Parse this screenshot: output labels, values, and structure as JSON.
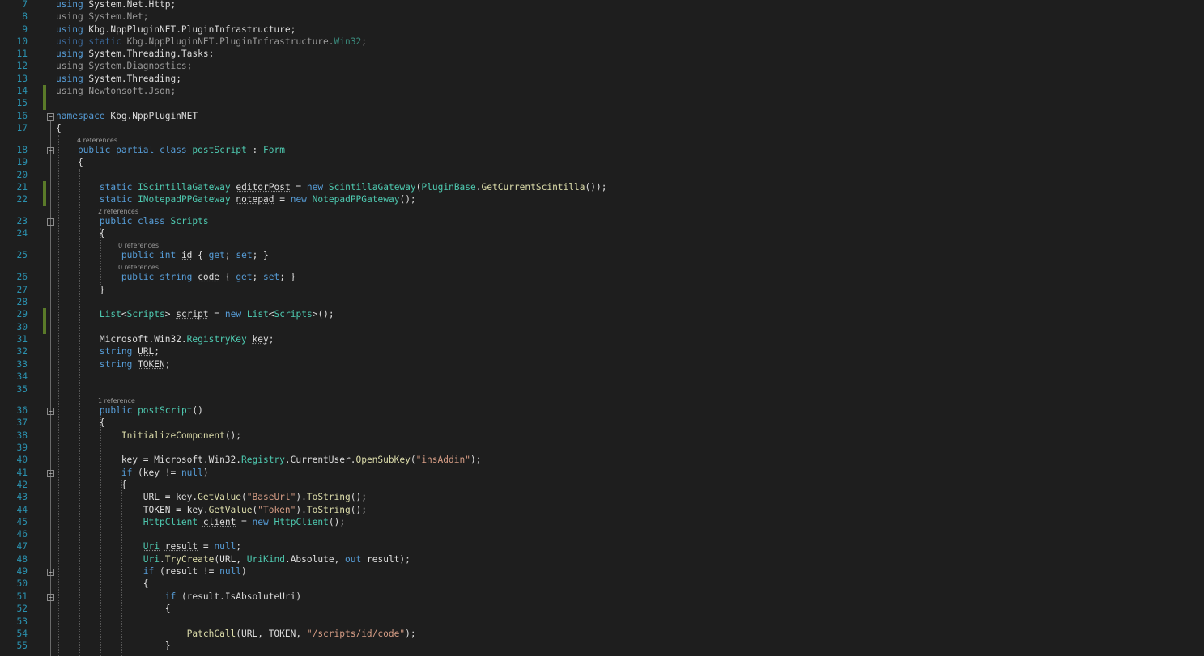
{
  "editor": {
    "background": "#1e1e1e",
    "language": "C#",
    "colors": {
      "keyword": "#569cd6",
      "type": "#4ec9b0",
      "method": "#dcdcaa",
      "string": "#d69d85",
      "line_number": "#2b91af",
      "unused_using": "#9b9b9b",
      "change_marker": "#5a7a29"
    },
    "lens": {
      "form_class": "4 references",
      "scripts_class": "2 references",
      "id_prop": "0 references",
      "code_prop": "0 references",
      "ctor": "1 reference"
    },
    "lines": [
      {
        "num": "7",
        "tokens": [
          {
            "t": "using",
            "c": "kw"
          },
          {
            "t": " System.Net.Http;",
            "c": "tx"
          }
        ]
      },
      {
        "num": "8",
        "tokens": [
          {
            "t": "using System.Net;",
            "c": "dim"
          }
        ]
      },
      {
        "num": "9",
        "tokens": [
          {
            "t": "using",
            "c": "kw"
          },
          {
            "t": " Kbg.NppPluginNET.PluginInfrastructure;",
            "c": "tx"
          }
        ]
      },
      {
        "num": "10",
        "tokens": [
          {
            "t": "using static",
            "c": "dimkw"
          },
          {
            "t": " Kbg.NppPluginNET.PluginInfrastructure.",
            "c": "dim"
          },
          {
            "t": "Win32",
            "c": "dimty"
          },
          {
            "t": ";",
            "c": "dim"
          }
        ]
      },
      {
        "num": "11",
        "tokens": [
          {
            "t": "using",
            "c": "kw"
          },
          {
            "t": " System.Threading.Tasks;",
            "c": "tx"
          }
        ]
      },
      {
        "num": "12",
        "tokens": [
          {
            "t": "using System.Diagnostics;",
            "c": "dim"
          }
        ]
      },
      {
        "num": "13",
        "tokens": [
          {
            "t": "using",
            "c": "kw"
          },
          {
            "t": " System.Threading;",
            "c": "tx"
          }
        ]
      },
      {
        "num": "14",
        "tokens": [
          {
            "t": "using Newtonsoft.Json;",
            "c": "dim"
          }
        ]
      },
      {
        "num": "15",
        "tokens": []
      },
      {
        "num": "16",
        "tokens": [
          {
            "t": "namespace",
            "c": "kw"
          },
          {
            "t": " Kbg.NppPluginNET",
            "c": "tx"
          }
        ]
      },
      {
        "num": "17",
        "tokens": [
          {
            "t": "{",
            "c": "tx"
          }
        ]
      },
      {
        "num": "18",
        "tokens": [
          {
            "t": "    ",
            "c": "tx"
          },
          {
            "t": "public partial class",
            "c": "kw"
          },
          {
            "t": " ",
            "c": "tx"
          },
          {
            "t": "postScript",
            "c": "ty"
          },
          {
            "t": " : ",
            "c": "tx"
          },
          {
            "t": "Form",
            "c": "ty"
          }
        ]
      },
      {
        "num": "19",
        "tokens": [
          {
            "t": "    {",
            "c": "tx"
          }
        ]
      },
      {
        "num": "20",
        "tokens": []
      },
      {
        "num": "21",
        "tokens": [
          {
            "t": "        ",
            "c": "tx"
          },
          {
            "t": "static",
            "c": "kw"
          },
          {
            "t": " ",
            "c": "tx"
          },
          {
            "t": "IScintillaGateway",
            "c": "ty"
          },
          {
            "t": " ",
            "c": "tx"
          },
          {
            "t": "editorPost",
            "c": "tx",
            "u": 1
          },
          {
            "t": " = ",
            "c": "tx"
          },
          {
            "t": "new",
            "c": "kw"
          },
          {
            "t": " ",
            "c": "tx"
          },
          {
            "t": "ScintillaGateway",
            "c": "ty"
          },
          {
            "t": "(",
            "c": "tx"
          },
          {
            "t": "PluginBase",
            "c": "ty"
          },
          {
            "t": ".",
            "c": "tx"
          },
          {
            "t": "GetCurrentScintilla",
            "c": "fn"
          },
          {
            "t": "());",
            "c": "tx"
          }
        ]
      },
      {
        "num": "22",
        "tokens": [
          {
            "t": "        ",
            "c": "tx"
          },
          {
            "t": "static",
            "c": "kw"
          },
          {
            "t": " ",
            "c": "tx"
          },
          {
            "t": "INotepadPPGateway",
            "c": "ty"
          },
          {
            "t": " ",
            "c": "tx"
          },
          {
            "t": "notepad",
            "c": "tx",
            "u": 1
          },
          {
            "t": " = ",
            "c": "tx"
          },
          {
            "t": "new",
            "c": "kw"
          },
          {
            "t": " ",
            "c": "tx"
          },
          {
            "t": "NotepadPPGateway",
            "c": "ty"
          },
          {
            "t": "();",
            "c": "tx"
          }
        ]
      },
      {
        "num": "23",
        "tokens": [
          {
            "t": "        ",
            "c": "tx"
          },
          {
            "t": "public class",
            "c": "kw"
          },
          {
            "t": " ",
            "c": "tx"
          },
          {
            "t": "Scripts",
            "c": "ty"
          }
        ]
      },
      {
        "num": "24",
        "tokens": [
          {
            "t": "        {",
            "c": "tx"
          }
        ]
      },
      {
        "num": "25",
        "tokens": [
          {
            "t": "            ",
            "c": "tx"
          },
          {
            "t": "public int",
            "c": "kw"
          },
          {
            "t": " ",
            "c": "tx"
          },
          {
            "t": "id",
            "c": "tx",
            "u": 1
          },
          {
            "t": " { ",
            "c": "tx"
          },
          {
            "t": "get",
            "c": "kw"
          },
          {
            "t": "; ",
            "c": "tx"
          },
          {
            "t": "set",
            "c": "kw"
          },
          {
            "t": "; }",
            "c": "tx"
          }
        ]
      },
      {
        "num": "26",
        "tokens": [
          {
            "t": "            ",
            "c": "tx"
          },
          {
            "t": "public string",
            "c": "kw"
          },
          {
            "t": " ",
            "c": "tx"
          },
          {
            "t": "code",
            "c": "tx",
            "u": 1
          },
          {
            "t": " { ",
            "c": "tx"
          },
          {
            "t": "get",
            "c": "kw"
          },
          {
            "t": "; ",
            "c": "tx"
          },
          {
            "t": "set",
            "c": "kw"
          },
          {
            "t": "; }",
            "c": "tx"
          }
        ]
      },
      {
        "num": "27",
        "tokens": [
          {
            "t": "        }",
            "c": "tx"
          }
        ]
      },
      {
        "num": "28",
        "tokens": []
      },
      {
        "num": "29",
        "tokens": [
          {
            "t": "        ",
            "c": "tx"
          },
          {
            "t": "List",
            "c": "ty"
          },
          {
            "t": "<",
            "c": "tx"
          },
          {
            "t": "Scripts",
            "c": "ty"
          },
          {
            "t": "> ",
            "c": "tx"
          },
          {
            "t": "script",
            "c": "tx",
            "u": 1
          },
          {
            "t": " = ",
            "c": "tx"
          },
          {
            "t": "new",
            "c": "kw"
          },
          {
            "t": " ",
            "c": "tx"
          },
          {
            "t": "List",
            "c": "ty"
          },
          {
            "t": "<",
            "c": "tx"
          },
          {
            "t": "Scripts",
            "c": "ty"
          },
          {
            "t": ">();",
            "c": "tx"
          }
        ]
      },
      {
        "num": "30",
        "tokens": []
      },
      {
        "num": "31",
        "tokens": [
          {
            "t": "        Microsoft.Win32.",
            "c": "tx"
          },
          {
            "t": "RegistryKey",
            "c": "ty"
          },
          {
            "t": " ",
            "c": "tx"
          },
          {
            "t": "key",
            "c": "tx",
            "u": 1
          },
          {
            "t": ";",
            "c": "tx"
          }
        ]
      },
      {
        "num": "32",
        "tokens": [
          {
            "t": "        ",
            "c": "tx"
          },
          {
            "t": "string",
            "c": "kw"
          },
          {
            "t": " ",
            "c": "tx"
          },
          {
            "t": "URL",
            "c": "tx",
            "u": 1
          },
          {
            "t": ";",
            "c": "tx"
          }
        ]
      },
      {
        "num": "33",
        "tokens": [
          {
            "t": "        ",
            "c": "tx"
          },
          {
            "t": "string",
            "c": "kw"
          },
          {
            "t": " ",
            "c": "tx"
          },
          {
            "t": "TOKEN",
            "c": "tx",
            "u": 1
          },
          {
            "t": ";",
            "c": "tx"
          }
        ]
      },
      {
        "num": "34",
        "tokens": []
      },
      {
        "num": "35",
        "tokens": []
      },
      {
        "num": "36",
        "tokens": [
          {
            "t": "        ",
            "c": "tx"
          },
          {
            "t": "public",
            "c": "kw"
          },
          {
            "t": " ",
            "c": "tx"
          },
          {
            "t": "postScript",
            "c": "ty"
          },
          {
            "t": "()",
            "c": "tx"
          }
        ]
      },
      {
        "num": "37",
        "tokens": [
          {
            "t": "        {",
            "c": "tx"
          }
        ]
      },
      {
        "num": "38",
        "tokens": [
          {
            "t": "            ",
            "c": "tx"
          },
          {
            "t": "InitializeComponent",
            "c": "fn"
          },
          {
            "t": "();",
            "c": "tx"
          }
        ]
      },
      {
        "num": "39",
        "tokens": []
      },
      {
        "num": "40",
        "tokens": [
          {
            "t": "            key = Microsoft.Win32.",
            "c": "tx"
          },
          {
            "t": "Registry",
            "c": "ty"
          },
          {
            "t": ".CurrentUser.",
            "c": "tx"
          },
          {
            "t": "OpenSubKey",
            "c": "fn"
          },
          {
            "t": "(",
            "c": "tx"
          },
          {
            "t": "\"insAddin\"",
            "c": "str"
          },
          {
            "t": ");",
            "c": "tx"
          }
        ]
      },
      {
        "num": "41",
        "tokens": [
          {
            "t": "            ",
            "c": "tx"
          },
          {
            "t": "if",
            "c": "kw"
          },
          {
            "t": " (key != ",
            "c": "tx"
          },
          {
            "t": "null",
            "c": "kw"
          },
          {
            "t": ")",
            "c": "tx"
          }
        ]
      },
      {
        "num": "42",
        "tokens": [
          {
            "t": "            {",
            "c": "tx"
          }
        ]
      },
      {
        "num": "43",
        "tokens": [
          {
            "t": "                URL = key.",
            "c": "tx"
          },
          {
            "t": "GetValue",
            "c": "fn"
          },
          {
            "t": "(",
            "c": "tx"
          },
          {
            "t": "\"BaseUrl\"",
            "c": "str"
          },
          {
            "t": ").",
            "c": "tx"
          },
          {
            "t": "ToString",
            "c": "fn"
          },
          {
            "t": "();",
            "c": "tx"
          }
        ]
      },
      {
        "num": "44",
        "tokens": [
          {
            "t": "                TOKEN = key.",
            "c": "tx"
          },
          {
            "t": "GetValue",
            "c": "fn"
          },
          {
            "t": "(",
            "c": "tx"
          },
          {
            "t": "\"Token\"",
            "c": "str"
          },
          {
            "t": ").",
            "c": "tx"
          },
          {
            "t": "ToString",
            "c": "fn"
          },
          {
            "t": "();",
            "c": "tx"
          }
        ]
      },
      {
        "num": "45",
        "tokens": [
          {
            "t": "                ",
            "c": "tx"
          },
          {
            "t": "HttpClient",
            "c": "ty"
          },
          {
            "t": " ",
            "c": "tx"
          },
          {
            "t": "client",
            "c": "tx",
            "u": 1
          },
          {
            "t": " = ",
            "c": "tx"
          },
          {
            "t": "new",
            "c": "kw"
          },
          {
            "t": " ",
            "c": "tx"
          },
          {
            "t": "HttpClient",
            "c": "ty"
          },
          {
            "t": "();",
            "c": "tx"
          }
        ]
      },
      {
        "num": "46",
        "tokens": []
      },
      {
        "num": "47",
        "tokens": [
          {
            "t": "                ",
            "c": "tx"
          },
          {
            "t": "Uri",
            "c": "ty",
            "u": 1
          },
          {
            "t": " ",
            "c": "tx"
          },
          {
            "t": "result",
            "c": "tx",
            "u": 1
          },
          {
            "t": " = ",
            "c": "tx"
          },
          {
            "t": "null",
            "c": "kw"
          },
          {
            "t": ";",
            "c": "tx"
          }
        ]
      },
      {
        "num": "48",
        "tokens": [
          {
            "t": "                ",
            "c": "tx"
          },
          {
            "t": "Uri",
            "c": "ty"
          },
          {
            "t": ".",
            "c": "tx"
          },
          {
            "t": "TryCreate",
            "c": "fn"
          },
          {
            "t": "(URL, ",
            "c": "tx"
          },
          {
            "t": "UriKind",
            "c": "ty"
          },
          {
            "t": ".Absolute, ",
            "c": "tx"
          },
          {
            "t": "out",
            "c": "kw"
          },
          {
            "t": " result);",
            "c": "tx"
          }
        ]
      },
      {
        "num": "49",
        "tokens": [
          {
            "t": "                ",
            "c": "tx"
          },
          {
            "t": "if",
            "c": "kw"
          },
          {
            "t": " (result != ",
            "c": "tx"
          },
          {
            "t": "null",
            "c": "kw"
          },
          {
            "t": ")",
            "c": "tx"
          }
        ]
      },
      {
        "num": "50",
        "tokens": [
          {
            "t": "                {",
            "c": "tx"
          }
        ]
      },
      {
        "num": "51",
        "tokens": [
          {
            "t": "                    ",
            "c": "tx"
          },
          {
            "t": "if",
            "c": "kw"
          },
          {
            "t": " (result.IsAbsoluteUri)",
            "c": "tx"
          }
        ]
      },
      {
        "num": "52",
        "tokens": [
          {
            "t": "                    {",
            "c": "tx"
          }
        ]
      },
      {
        "num": "53",
        "tokens": []
      },
      {
        "num": "54",
        "tokens": [
          {
            "t": "                        ",
            "c": "tx"
          },
          {
            "t": "PatchCall",
            "c": "fn"
          },
          {
            "t": "(URL, TOKEN, ",
            "c": "tx"
          },
          {
            "t": "\"/scripts/id/code\"",
            "c": "str"
          },
          {
            "t": ");",
            "c": "tx"
          }
        ]
      },
      {
        "num": "55",
        "tokens": [
          {
            "t": "                    }",
            "c": "tx"
          }
        ]
      }
    ]
  }
}
